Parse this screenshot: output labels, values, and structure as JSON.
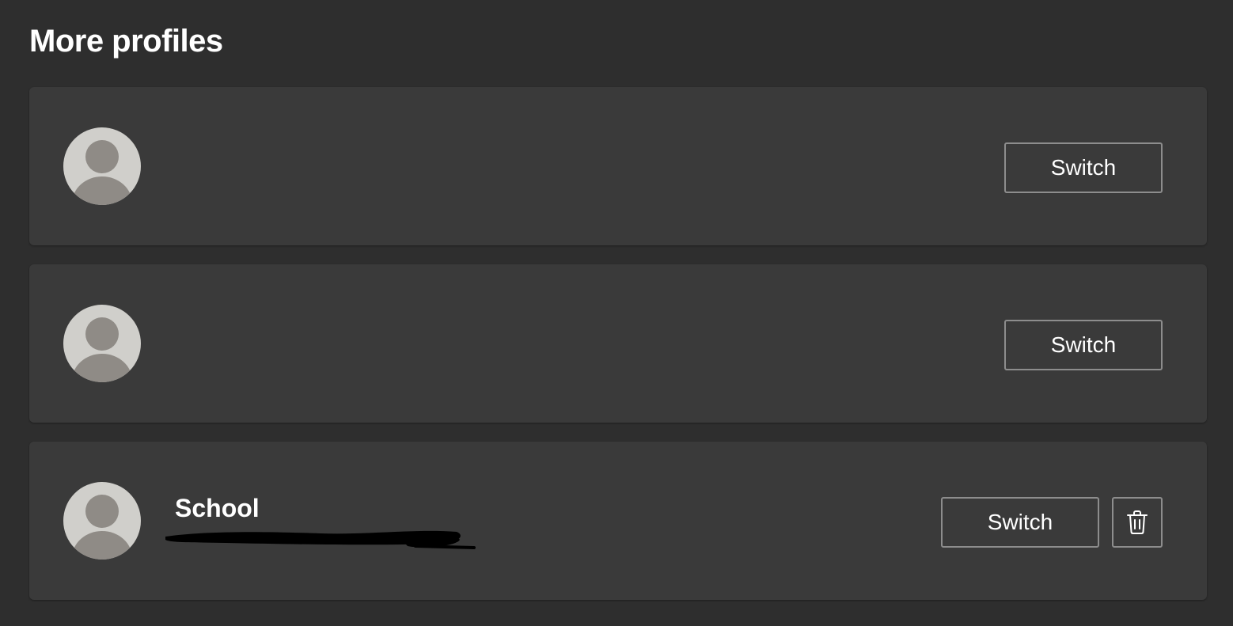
{
  "section": {
    "title": "More profiles"
  },
  "profiles": [
    {
      "name": "",
      "switch_label": "Switch",
      "avatar_icon": "default-avatar-icon"
    },
    {
      "name": "",
      "switch_label": "Switch",
      "avatar_icon": "default-avatar-icon"
    },
    {
      "name": "School",
      "switch_label": "Switch",
      "avatar_icon": "default-avatar-icon",
      "delete_icon": "trash-icon"
    }
  ],
  "colors": {
    "background": "#2e2e2e",
    "card": "#3a3a3a",
    "button_border": "#8d8d8d",
    "avatar_bg": "#d0cfcb",
    "avatar_fg": "#8f8b86",
    "text": "#ffffff"
  }
}
